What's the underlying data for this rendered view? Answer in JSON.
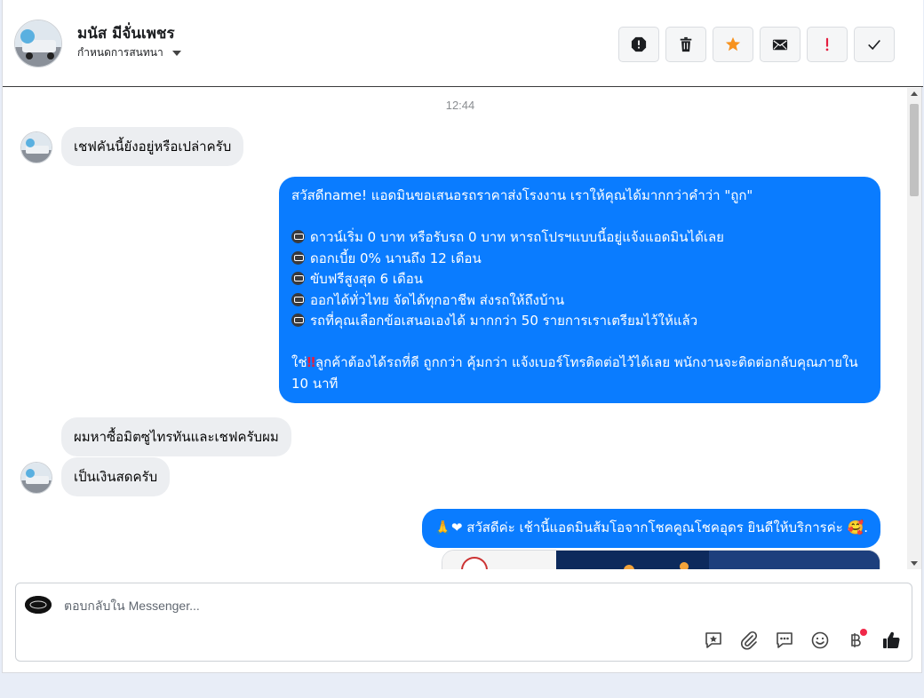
{
  "header": {
    "contact_name": "มนัส มีจั่นเพชร",
    "assign_label": "กำหนดการสนทนา",
    "actions": [
      "spam",
      "delete",
      "star",
      "mail",
      "important",
      "done"
    ]
  },
  "chat": {
    "timestamp": "12:44",
    "msg1": "เชฟคันนี้ยังอยู่หรือเปล่าครับ",
    "out1": {
      "line1": "สวัสดีname! แอดมินขอเสนอรถราคาส่งโรงงาน เราให้คุณได้มากกว่าคำว่า \"ถูก\"",
      "b1": "ดาวน์เริ่ม 0 บาท หรือรับรถ 0 บาท หารถโปรฯแบบนี้อยู่แจ้งแอดมินได้เลย",
      "b2": "ดอกเบี้ย 0% นานถึง 12 เดือน",
      "b3": "ขับฟรีสูงสุด 6 เดือน",
      "b4": "ออกได้ทั่วไทย จัดได้ทุกอาชีพ ส่งรถให้ถึงบ้าน",
      "b5": "รถที่คุณเลือกข้อเสนอเองได้ มากกว่า 50 รายการเราเตรียมไว้ให้แล้ว",
      "closing_pre": "ใช่",
      "closing_mark": "‼",
      "closing_rest": "ลูกค้าต้องได้รถที่ดี ถูกกว่า คุ้มกว่า แจ้งเบอร์โทรติดต่อไว้ได้เลย พนักงานจะติดต่อกลับคุณภายใน 10 นาที"
    },
    "msg2": "ผมหาซื้อมิตซูไทรทันและเชฟครับผม",
    "msg3": "เป็นเงินสดครับ",
    "out2": {
      "emoji_pre": "🙏❤",
      "text": "สวัสดีค่ะ เช้านี้แอดมินส้มโอจากโชคคูณโชคอุดร ยินดีให้บริการค่ะ",
      "emoji_post": "🥰."
    }
  },
  "composer": {
    "placeholder": "ตอบกลับใน Messenger..."
  },
  "colors": {
    "outgoing": "#0a7cff",
    "incoming": "#eceef1",
    "star": "#f7921e",
    "important": "#e41e3f"
  }
}
